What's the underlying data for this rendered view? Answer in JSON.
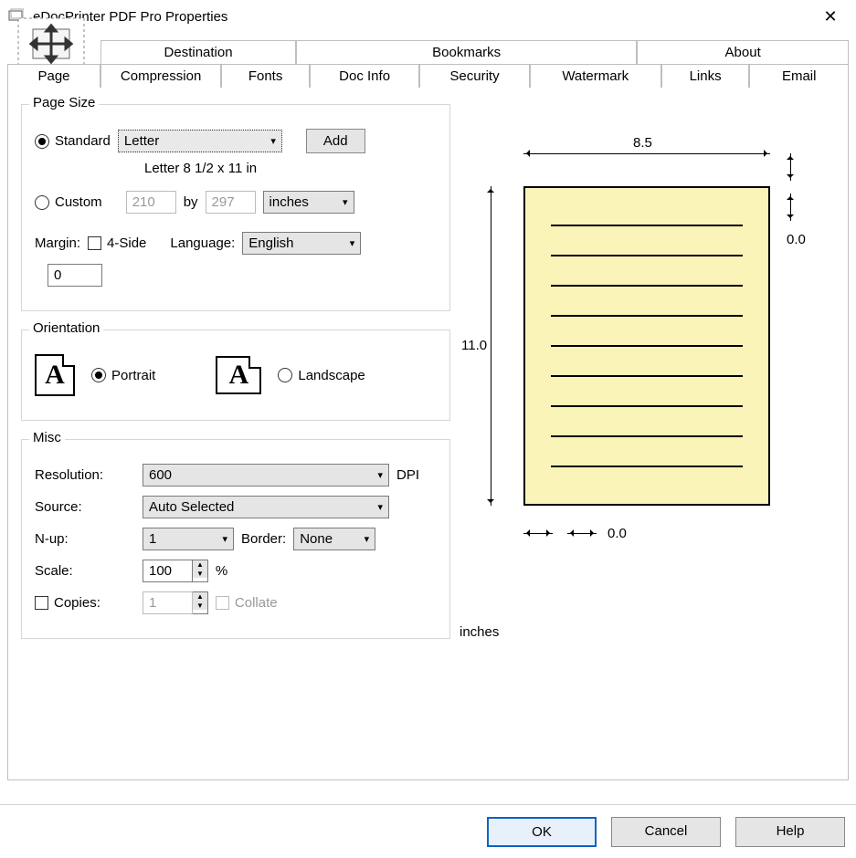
{
  "window": {
    "title": "eDocPrinter PDF Pro Properties"
  },
  "tabs": {
    "row1": [
      "Destination",
      "Bookmarks",
      "About"
    ],
    "row2": [
      "Page",
      "Compression",
      "Fonts",
      "Doc Info",
      "Security",
      "Watermark",
      "Links",
      "Email"
    ],
    "active": "Page"
  },
  "pagesize": {
    "legend": "Page Size",
    "standard_label": "Standard",
    "standard_value": "Letter",
    "add_label": "Add",
    "desc": "Letter 8 1/2 x 11 in",
    "custom_label": "Custom",
    "custom_w": "210",
    "by_label": "by",
    "custom_h": "297",
    "unit_value": "inches",
    "margin_label": "Margin:",
    "fourside_label": "4-Side",
    "language_label": "Language:",
    "language_value": "English",
    "margin_value": "0"
  },
  "orientation": {
    "legend": "Orientation",
    "portrait_label": "Portrait",
    "landscape_label": "Landscape"
  },
  "misc": {
    "legend": "Misc",
    "resolution_label": "Resolution:",
    "resolution_value": "600",
    "dpi_label": "DPI",
    "source_label": "Source:",
    "source_value": "Auto Selected",
    "nup_label": "N-up:",
    "nup_value": "1",
    "border_label": "Border:",
    "border_value": "None",
    "scale_label": "Scale:",
    "scale_value": "100",
    "percent": "%",
    "copies_label": "Copies:",
    "copies_value": "1",
    "collate_label": "Collate"
  },
  "preview": {
    "width": "8.5",
    "height": "11.0",
    "margin_v": "0.0",
    "margin_h": "0.0",
    "unit": "inches"
  },
  "buttons": {
    "ok": "OK",
    "cancel": "Cancel",
    "help": "Help"
  }
}
